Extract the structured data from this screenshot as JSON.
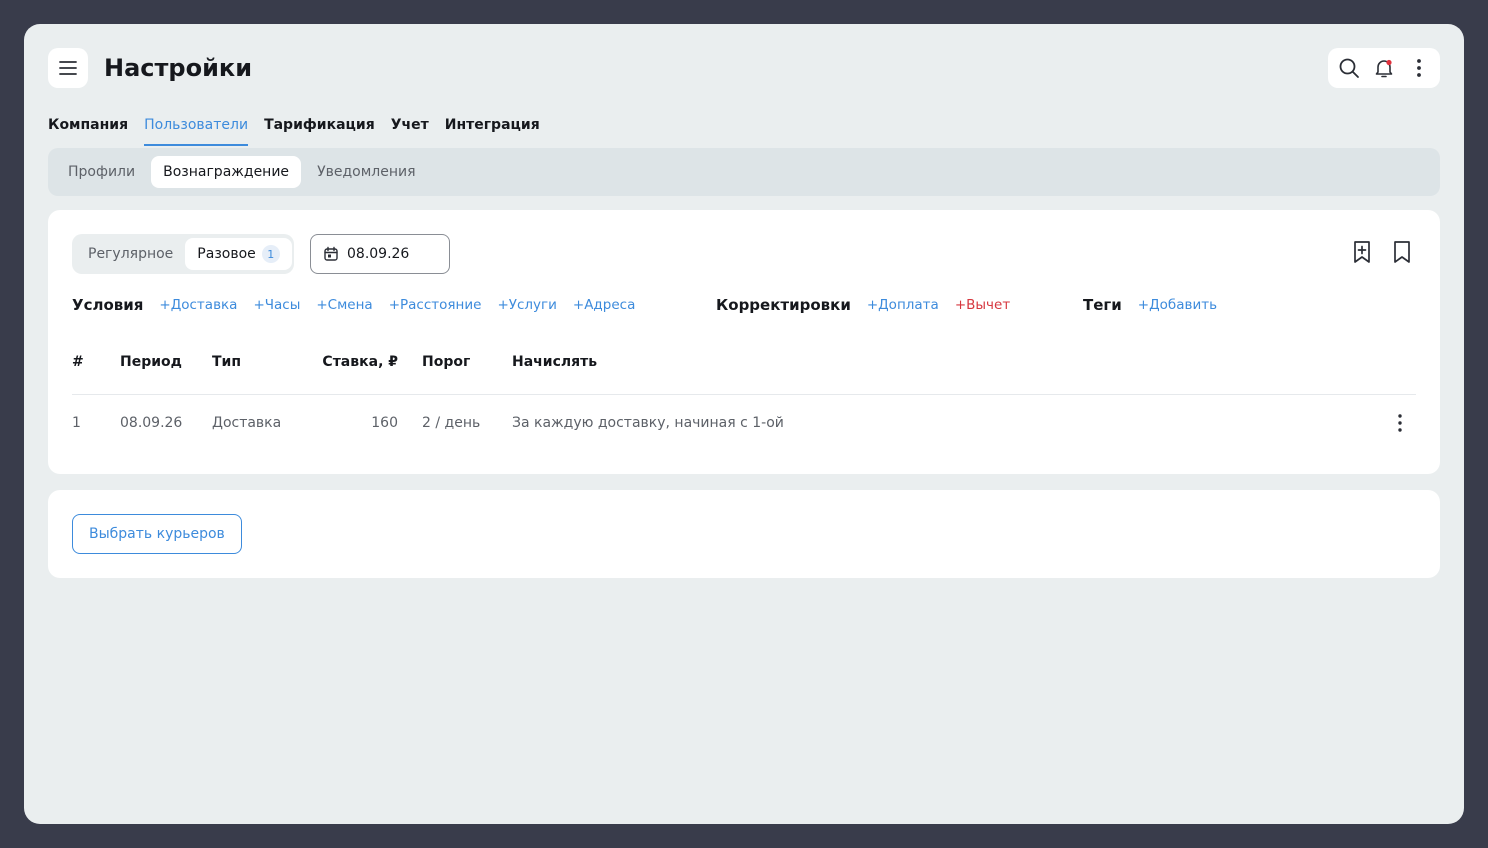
{
  "header": {
    "title": "Настройки",
    "icons": {
      "menu": "hamburger-icon",
      "search": "search-icon",
      "notifications": "bell-icon",
      "more": "more-vertical-icon"
    },
    "notification_dot_color": "#e0303c"
  },
  "tabs": [
    {
      "label": "Компания",
      "active": false
    },
    {
      "label": "Пользователи",
      "active": true
    },
    {
      "label": "Тарификация",
      "active": false
    },
    {
      "label": "Учет",
      "active": false
    },
    {
      "label": "Интеграция",
      "active": false
    }
  ],
  "subtabs": [
    {
      "label": "Профили",
      "active": false
    },
    {
      "label": "Вознаграждение",
      "active": true
    },
    {
      "label": "Уведомления",
      "active": false
    }
  ],
  "reward": {
    "segments": [
      {
        "label": "Регулярное",
        "active": false
      },
      {
        "label": "Разовое",
        "active": true,
        "badge": "1"
      }
    ],
    "date": "08.09.26",
    "conditions": {
      "label": "Условия",
      "links": [
        "+Доставка",
        "+Часы",
        "+Смена",
        "+Расстояние",
        "+Услуги",
        "+Адреса"
      ]
    },
    "corrections": {
      "label": "Корректировки",
      "add": "+Доплата",
      "deduct": "+Вычет"
    },
    "tags": {
      "label": "Теги",
      "add": "+Добавить"
    },
    "table": {
      "headers": [
        "#",
        "Период",
        "Тип",
        "Ставка, ₽",
        "Порог",
        "Начислять"
      ],
      "rows": [
        [
          "1",
          "08.09.26",
          "Доставка",
          "160",
          "2 / день",
          "За каждую доставку, начиная с 1-ой"
        ]
      ]
    }
  },
  "bottom": {
    "select_couriers": "Выбрать курьеров"
  },
  "colors": {
    "accent": "#3d8bdc",
    "danger": "#d6373f",
    "frame": "#393c4b",
    "surface": "#eaeeef"
  }
}
